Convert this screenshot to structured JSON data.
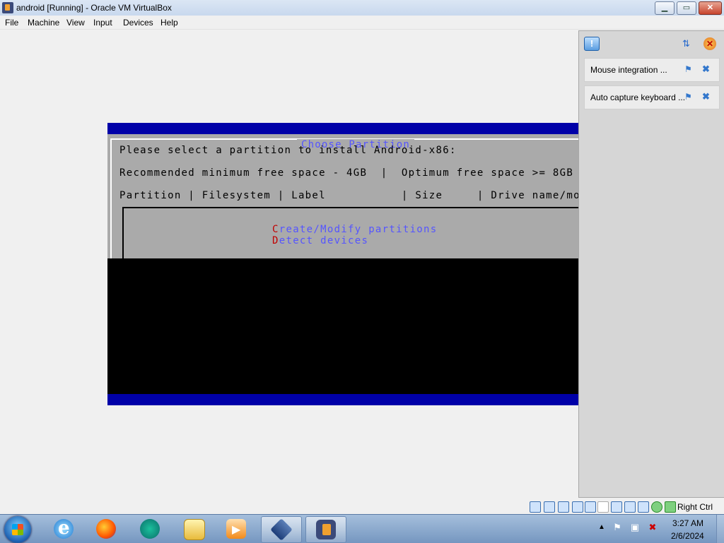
{
  "window": {
    "title": "android  [Running] - Oracle VM VirtualBox",
    "minimize_label": "▁",
    "maximize_label": "▭",
    "close_label": "✕"
  },
  "menu": {
    "items": [
      "File",
      "Machine",
      "View",
      "Input",
      "Devices",
      "Help"
    ]
  },
  "vm": {
    "dialog_title": "Choose Partition",
    "prompt": "Please select a partition to install Android-x86:",
    "space_info": "Recommended minimum free space - 4GB  |  Optimum free space >= 8GB",
    "columns": "Partition | Filesystem | Label           | Size     | Drive name/model",
    "options": [
      {
        "hotkey": "C",
        "rest": "reate/Modify partitions"
      },
      {
        "hotkey": "D",
        "rest": "etect devices"
      }
    ],
    "colors": {
      "blue_band": "#0000a8",
      "dialog_bg": "#aaaaaa",
      "option_text": "#5555ff",
      "hotkey": "#c00000"
    }
  },
  "notifications": {
    "items": [
      {
        "text": "Mouse integration ..."
      },
      {
        "text": "Auto capture keyboard ..."
      }
    ]
  },
  "statusbar": {
    "icons": [
      "hard-disk-icon",
      "optical-drive-icon",
      "audio-icon",
      "network-icon",
      "usb-icon",
      "shared-folders-icon",
      "display-icon",
      "video-capture-icon",
      "cpu-icon",
      "mouse-integration-icon",
      "keyboard-capture-icon"
    ],
    "host_key": "Right Ctrl"
  },
  "taskbar": {
    "apps": [
      "internet-explorer",
      "firefox",
      "chat-app",
      "windows-explorer",
      "media-player",
      "virtualbox-manager",
      "virtualbox-vm"
    ],
    "clock_time": "3:27 AM",
    "clock_date": "2/6/2024"
  }
}
